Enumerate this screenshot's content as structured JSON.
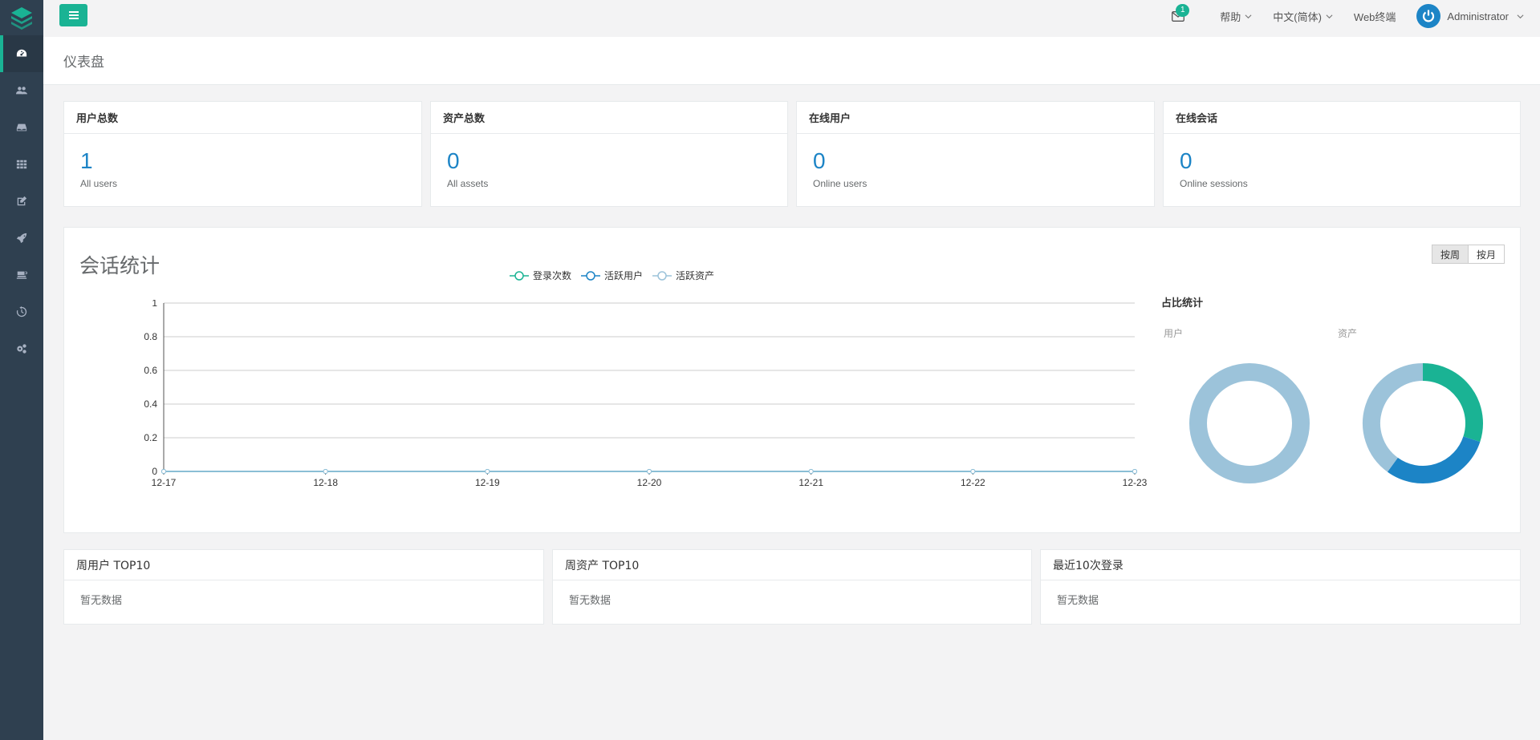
{
  "topbar": {
    "mail_badge": "1",
    "help": "帮助",
    "language": "中文(简体)",
    "web_terminal": "Web终端",
    "user": "Administrator"
  },
  "page": {
    "title": "仪表盘"
  },
  "sidebar": {
    "icons": [
      "dashboard-icon",
      "users-icon",
      "assets-icon",
      "apps-icon",
      "perms-icon",
      "rocket-icon",
      "terminal-icon",
      "history-icon",
      "settings-icon"
    ]
  },
  "stats": [
    {
      "title": "用户总数",
      "value": "1",
      "sub": "All users"
    },
    {
      "title": "资产总数",
      "value": "0",
      "sub": "All assets"
    },
    {
      "title": "在线用户",
      "value": "0",
      "sub": "Online users"
    },
    {
      "title": "在线会话",
      "value": "0",
      "sub": "Online sessions"
    }
  ],
  "session": {
    "title": "会话统计",
    "btn_week": "按周",
    "btn_month": "按月",
    "ratio_title": "占比统计",
    "donut_user_label": "用户",
    "donut_asset_label": "资产"
  },
  "chart_data": [
    {
      "type": "line",
      "categories": [
        "12-17",
        "12-18",
        "12-19",
        "12-20",
        "12-21",
        "12-22",
        "12-23"
      ],
      "series": [
        {
          "name": "登录次数",
          "values": [
            0,
            0,
            0,
            0,
            0,
            0,
            0
          ],
          "color": "#1ab394"
        },
        {
          "name": "活跃用户",
          "values": [
            0,
            0,
            0,
            0,
            0,
            0,
            0
          ],
          "color": "#1c84c6"
        },
        {
          "name": "活跃资产",
          "values": [
            0,
            0,
            0,
            0,
            0,
            0,
            0
          ],
          "color": "#9cc3da"
        }
      ],
      "yticks": [
        "0",
        "0.2",
        "0.4",
        "0.6",
        "0.8",
        "1"
      ],
      "ylim": [
        0,
        1
      ],
      "grid": true,
      "legend": "top"
    },
    {
      "type": "pie",
      "label": "用户",
      "slices": [
        {
          "value": 1,
          "color": "#9cc3da"
        }
      ]
    },
    {
      "type": "pie",
      "label": "资产",
      "slices": [
        {
          "value": 0.3,
          "color": "#1ab394"
        },
        {
          "value": 0.3,
          "color": "#1c84c6"
        },
        {
          "value": 0.4,
          "color": "#9cc3da"
        }
      ]
    }
  ],
  "bottom": [
    {
      "title": "周用户 TOP10",
      "empty": "暂无数据"
    },
    {
      "title": "周资产 TOP10",
      "empty": "暂无数据"
    },
    {
      "title": "最近10次登录",
      "empty": "暂无数据"
    }
  ],
  "colors": {
    "accent": "#1ab394",
    "blue": "#1c84c6",
    "light_blue": "#9cc3da",
    "sidebar": "#2f4050"
  }
}
